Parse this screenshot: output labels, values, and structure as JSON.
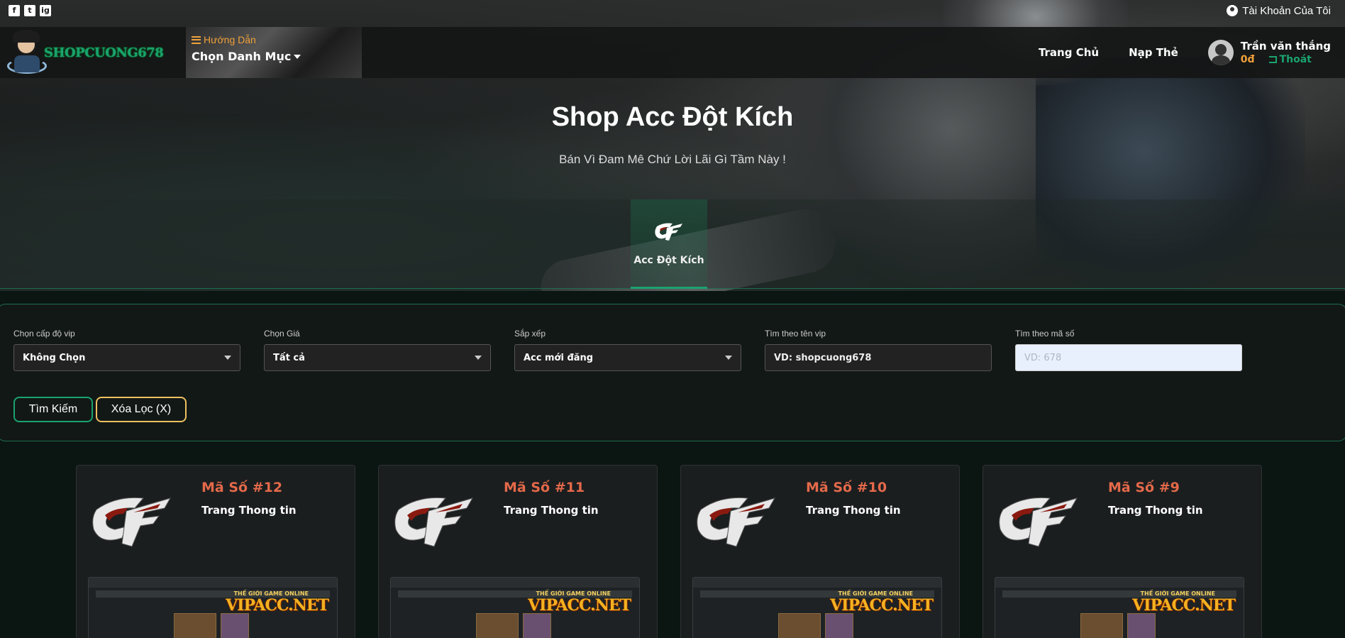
{
  "topbar": {
    "social": [
      "f",
      "t",
      "ig"
    ],
    "account_label": "Tài Khoản Của Tôi"
  },
  "navbar": {
    "logo_text": "SHOPCUONG678",
    "guide_label": "Hướng Dẫn",
    "menu_label": "Chọn Danh Mục",
    "links": [
      "Trang Chủ",
      "Nạp Thẻ"
    ],
    "user": {
      "name": "Trần văn thắng",
      "balance": "0đ",
      "logout": "Thoát"
    }
  },
  "hero": {
    "title": "Shop Acc Đột Kích",
    "subtitle": "Bán Vì Đam Mê Chứ Lời Lãi Gì Tầm Này !"
  },
  "categories": [
    {
      "label": "Acc Đột Kích"
    }
  ],
  "filters": {
    "vip_level": {
      "label": "Chọn cấp độ vip",
      "value": "Không Chọn"
    },
    "price": {
      "label": "Chọn Giá",
      "value": "Tất cả"
    },
    "sort": {
      "label": "Sắp xếp",
      "value": "Acc mới đăng"
    },
    "vip_name": {
      "label": "Tìm theo tên vip",
      "value": "VD: shopcuong678"
    },
    "code": {
      "label": "Tìm theo mã số",
      "placeholder": "VD: 678"
    },
    "search_button": "Tìm Kiếm",
    "clear_button": "Xóa Lọc (X)"
  },
  "cards": [
    {
      "code": "Mã Số #12",
      "desc": "Trang Thong tin",
      "watermark": "VIPACC.NET",
      "watermark_sub": "THẾ GIỚI GAME ONLINE"
    },
    {
      "code": "Mã Số #11",
      "desc": "Trang Thong tin",
      "watermark": "VIPACC.NET",
      "watermark_sub": "THẾ GIỚI GAME ONLINE"
    },
    {
      "code": "Mã Số #10",
      "desc": "Trang Thong tin",
      "watermark": "VIPACC.NET",
      "watermark_sub": "THẾ GIỚI GAME ONLINE"
    },
    {
      "code": "Mã Số #9",
      "desc": "Trang Thong tin",
      "watermark": "VIPACC.NET",
      "watermark_sub": "THẾ GIỚI GAME ONLINE"
    }
  ],
  "colors": {
    "accent_green": "#1aa36f",
    "accent_orange": "#f0a13a",
    "code_red": "#e4694a"
  }
}
